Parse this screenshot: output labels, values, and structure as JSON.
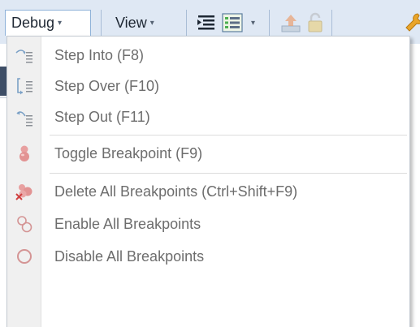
{
  "toolbar": {
    "debug_label": "Debug",
    "view_label": "View",
    "caret": "▾",
    "icons": [
      "indent-icon",
      "list-view-icon",
      "upload-icon",
      "unlock-icon",
      "wrench-icon"
    ]
  },
  "menu": {
    "items": [
      {
        "label": "Step Into (F8)",
        "icon": "step-into-icon"
      },
      {
        "label": "Step Over (F10)",
        "icon": "step-over-icon"
      },
      {
        "label": "Step Out (F11)",
        "icon": "step-out-icon"
      },
      {
        "label": "Toggle Breakpoint (F9)",
        "icon": "breakpoint-icon"
      },
      {
        "label": "Delete All Breakpoints (Ctrl+Shift+F9)",
        "icon": "delete-breakpoints-icon"
      },
      {
        "label": "Enable All Breakpoints",
        "icon": "enable-breakpoints-icon"
      },
      {
        "label": "Disable All Breakpoints",
        "icon": "disable-breakpoints-icon"
      }
    ],
    "enabled": false
  },
  "colors": {
    "toolbar_bg": "#dfe8f4",
    "disabled_text": "#6d6d6d",
    "breakpoint_red": "#e8a0a0",
    "delete_x": "#d04040"
  }
}
